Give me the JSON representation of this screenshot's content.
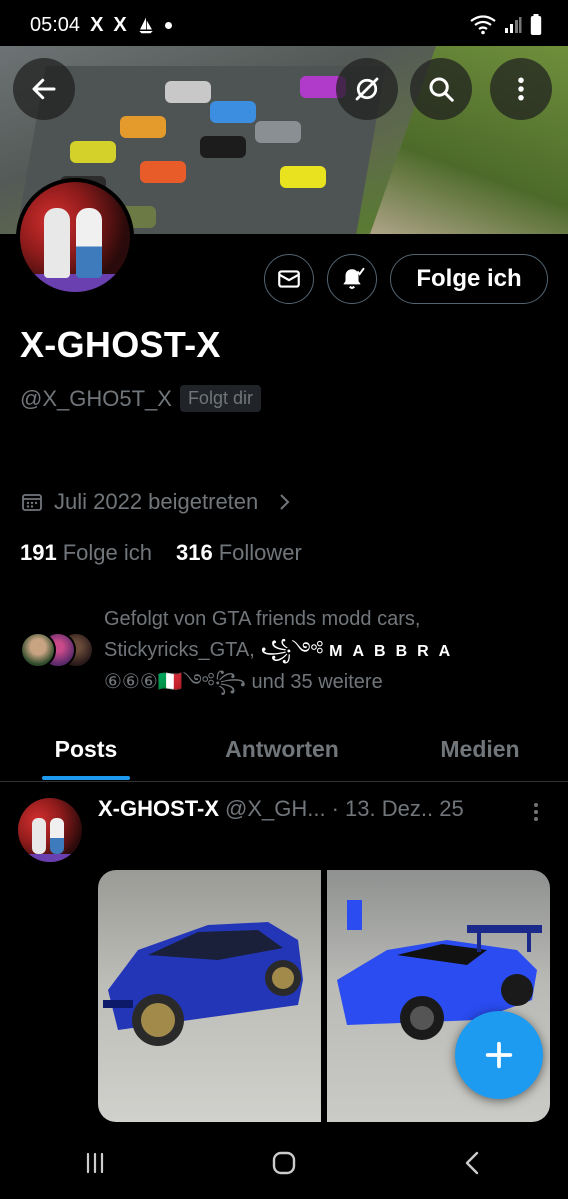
{
  "status_bar": {
    "time": "05:04",
    "notif_icons": [
      "X",
      "X"
    ]
  },
  "header": {
    "back_icon": "arrow-left-icon",
    "toggle_icon": "slashed-circle-icon",
    "search_icon": "search-icon",
    "more_icon": "more-vertical-icon"
  },
  "profile": {
    "display_name": "X-GHOST-X",
    "handle": "@X_GHO5T_X",
    "follows_you": "Folgt dir",
    "joined": "Juli 2022 beigetreten",
    "following_count": "191",
    "following_label": "Folge ich",
    "followers_count": "316",
    "followers_label": "Follower",
    "follow_button": "Folge ich",
    "followed_by_line1": "Gefolgt von GTA friends modd cars,",
    "followed_by_line2a": "Stickyricks_GTA, ",
    "followed_by_line2b": "꧁༺",
    "followed_by_spaced": "MABBRA",
    "followed_by_line3a": "⑥⑥⑥🇮🇹༺꧂",
    "followed_by_line3b": " und 35 weitere"
  },
  "tabs": [
    "Posts",
    "Antworten",
    "Medien"
  ],
  "post": {
    "name": "X-GHOST-X",
    "handle": "@X_GH...",
    "date": "· 13. Dez.. 25"
  },
  "colors": {
    "accent": "#1d9bf0",
    "muted": "#71767b",
    "border": "#536471"
  }
}
